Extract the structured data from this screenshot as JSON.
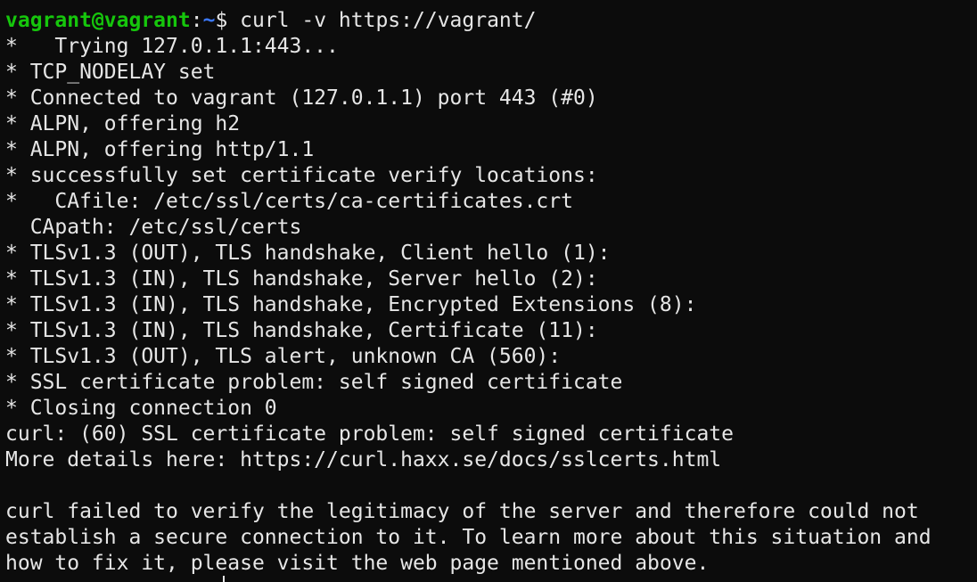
{
  "prompt": {
    "user_host": "vagrant@vagrant",
    "separator": ":",
    "path": "~",
    "symbol": "$",
    "command": " curl -v https://vagrant/"
  },
  "output_lines": [
    "*   Trying 127.0.1.1:443...",
    "* TCP_NODELAY set",
    "* Connected to vagrant (127.0.1.1) port 443 (#0)",
    "* ALPN, offering h2",
    "* ALPN, offering http/1.1",
    "* successfully set certificate verify locations:",
    "*   CAfile: /etc/ssl/certs/ca-certificates.crt",
    "  CApath: /etc/ssl/certs",
    "* TLSv1.3 (OUT), TLS handshake, Client hello (1):",
    "* TLSv1.3 (IN), TLS handshake, Server hello (2):",
    "* TLSv1.3 (IN), TLS handshake, Encrypted Extensions (8):",
    "* TLSv1.3 (IN), TLS handshake, Certificate (11):",
    "* TLSv1.3 (OUT), TLS alert, unknown CA (560):",
    "* SSL certificate problem: self signed certificate",
    "* Closing connection 0",
    "curl: (60) SSL certificate problem: self signed certificate",
    "More details here: https://curl.haxx.se/docs/sslcerts.html",
    "",
    "curl failed to verify the legitimacy of the server and therefore could not",
    "establish a secure connection to it. To learn more about this situation and",
    "how to fix it, please visit the web page mentioned above."
  ],
  "colors": {
    "background": "#0c0c0c",
    "foreground": "#e6e6e6",
    "user_host": "#16c60c",
    "path": "#3b78ff"
  }
}
